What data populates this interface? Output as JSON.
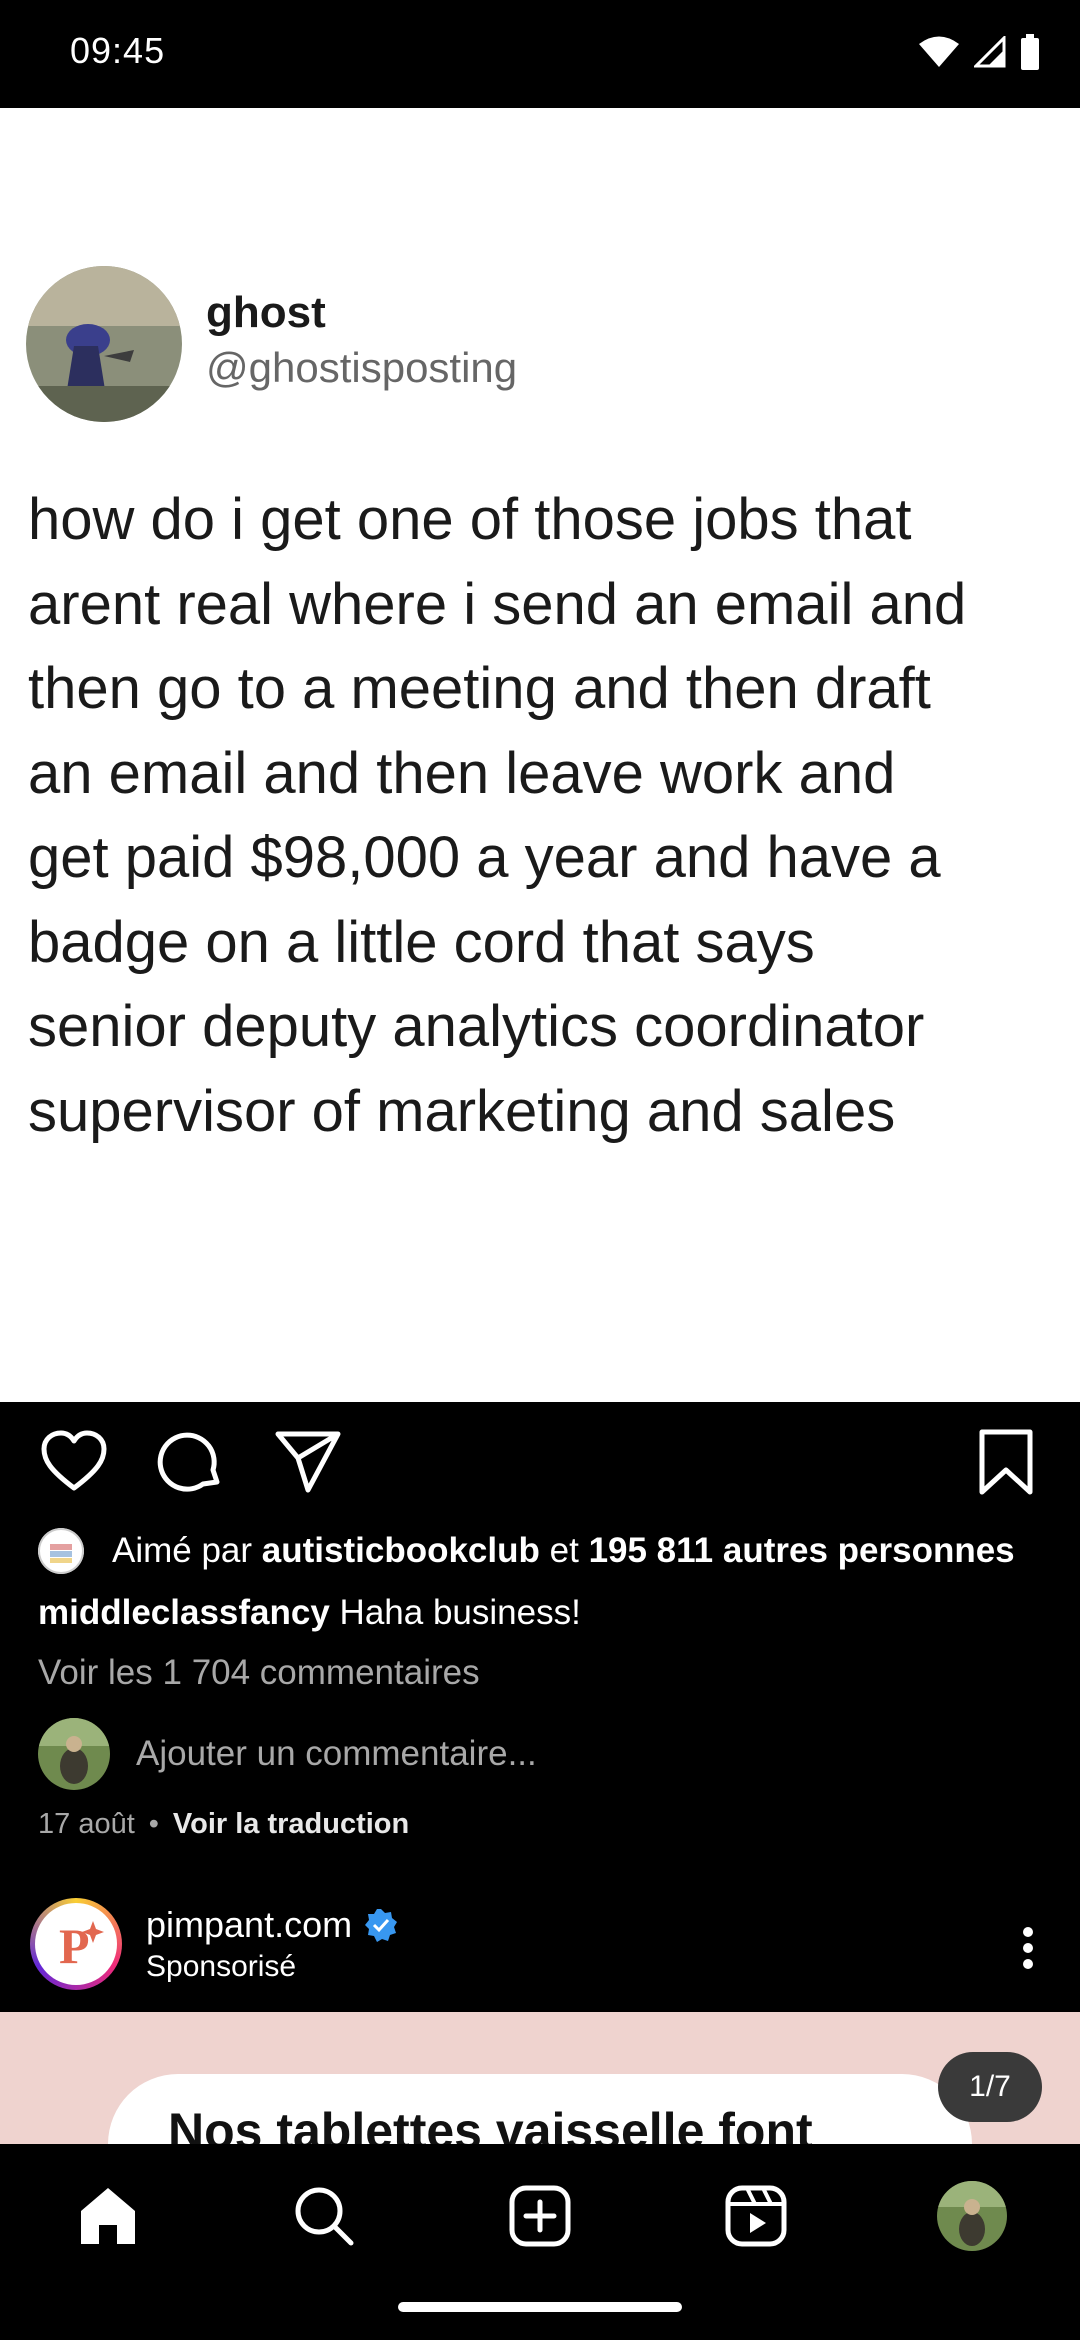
{
  "status_bar": {
    "time": "09:45"
  },
  "post1": {
    "tweet": {
      "name": "ghost",
      "handle": "@ghostisposting",
      "text": "how do i get one of those jobs that\narent real where i send an email and\nthen go to a meeting and then draft\nan email and then leave work and\nget paid $98,000 a year and have a\nbadge on a little cord that says\nsenior deputy analytics coordinator\nsupervisor of marketing and sales"
    },
    "likes": {
      "prefix": "Aimé par",
      "user": "autisticbookclub",
      "joiner": "et",
      "others": "195 811 autres personnes"
    },
    "caption": {
      "user": "middleclassfancy",
      "text": "Haha business!"
    },
    "view_comments": "Voir les 1 704 commentaires",
    "comment_placeholder": "Ajouter un commentaire...",
    "date": "17 août",
    "separator": "•",
    "translate": "Voir la traduction"
  },
  "post2": {
    "username": "pimpant.com",
    "sponsored": "Sponsorisé",
    "ad_text": "Nos tablettes vaisselle font",
    "counter": "1/7"
  },
  "colors": {
    "background": "#000000",
    "verified": "#3897f0",
    "secondary_text": "#a8a8a8",
    "ad_bg": "#efd3cf"
  },
  "icons": [
    "wifi-icon",
    "signal-icon",
    "battery-icon",
    "heart-icon",
    "comment-icon",
    "share-icon",
    "bookmark-icon",
    "verified-icon",
    "more-icon",
    "home-icon",
    "search-icon",
    "create-icon",
    "reels-icon"
  ]
}
